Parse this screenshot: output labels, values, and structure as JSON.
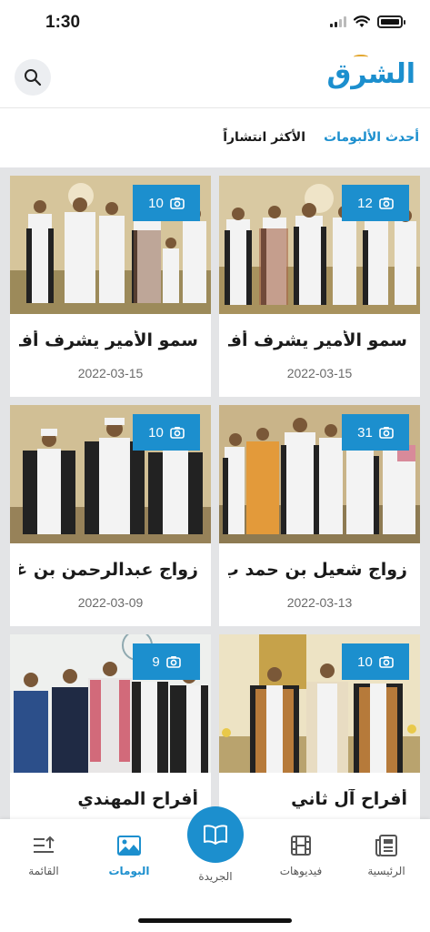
{
  "status_bar": {
    "time": "1:30"
  },
  "header": {
    "logo_text": "الشرق",
    "search_icon": "search-icon"
  },
  "tabs": {
    "latest": "أحدث الألبومات",
    "popular": "الأكثر انتشاراً"
  },
  "albums": [
    {
      "title": "سمو الأمير يشرف أف...",
      "date": "2022-03-15",
      "count": "12"
    },
    {
      "title": "سمو الأمير يشرف أف...",
      "date": "2022-03-15",
      "count": "10"
    },
    {
      "title": "زواج شعيل بن حمد ب...",
      "date": "2022-03-13",
      "count": "31"
    },
    {
      "title": "زواج عبدالرحمن بن غا...",
      "date": "2022-03-09",
      "count": "10"
    },
    {
      "title": "أفراح آل ثاني",
      "date": "",
      "count": "10"
    },
    {
      "title": "أفراح المهندي",
      "date": "",
      "count": "9"
    }
  ],
  "bottom_nav": {
    "home": "الرئيسية",
    "videos": "فيديوهات",
    "newspaper": "الجريدة",
    "albums": "البومات",
    "list": "القائمة"
  },
  "colors": {
    "accent": "#1c8fce",
    "logo_swirl": "#e3a72f",
    "grid_bg": "#e3e4e6"
  }
}
